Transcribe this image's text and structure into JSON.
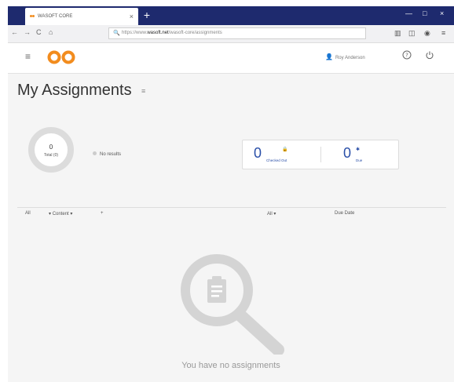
{
  "browser": {
    "tab_title": "WASOFT CORE",
    "tab_close": "×",
    "new_tab": "+",
    "url_prefix": "https://www.",
    "url_domain": "wasoft.net",
    "url_path": "/wasoft-core/assignments",
    "back": "←",
    "forward": "→",
    "reload": "C",
    "home": "⌂"
  },
  "header": {
    "menu_icon": "≡",
    "user_name": "Roy Anderson",
    "help_icon": "?",
    "power_icon": "⏻"
  },
  "page": {
    "title": "My Assignments",
    "title_icon": "≡"
  },
  "summary": {
    "donut_count": "0",
    "donut_label": "Total (0)",
    "legend_label": "No results"
  },
  "stats": {
    "checked_out_count": "0",
    "checked_out_label": "Checked Out",
    "due_count": "0",
    "due_label": "Due"
  },
  "filters": {
    "all_left": "All",
    "content": "Content",
    "add": "+",
    "all_right": "All",
    "due_date": "Due Date"
  },
  "empty_state": {
    "message": "You have no assignments"
  },
  "colors": {
    "tabbar": "#1e2a6e",
    "accent": "#2a4fa8",
    "logo": "#f28c1e"
  }
}
